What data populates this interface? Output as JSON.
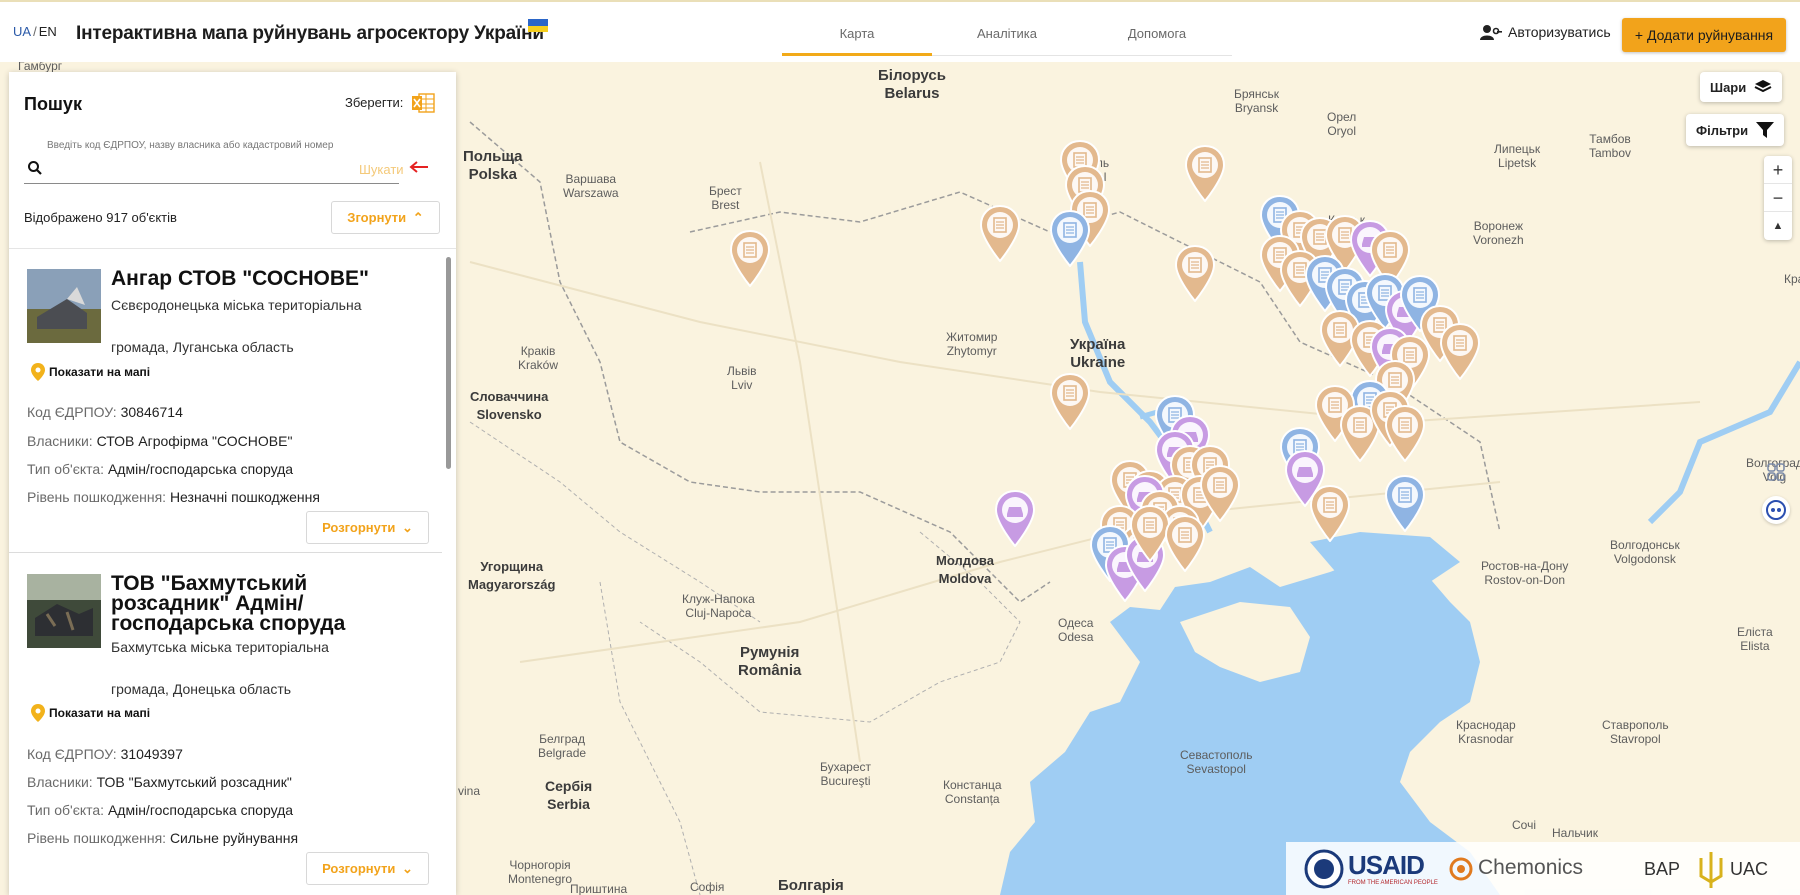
{
  "header": {
    "lang_ua": "UA",
    "lang_sep": "/",
    "lang_en": "EN",
    "title": "Інтерактивна мапа руйнувань агросектору України",
    "nav": [
      "Карта",
      "Аналітика",
      "Допомога"
    ],
    "active_nav": "Карта",
    "login": "Авторизуватись",
    "add_button": "+ Додати руйнування",
    "colors": {
      "accent": "#f2a31b",
      "flag_blue": "#2b66c8",
      "flag_yellow": "#f6cf1e"
    }
  },
  "sidebar": {
    "title": "Пошук",
    "save_label": "Зберегти:",
    "save_icon": "excel-icon",
    "search_hint": "Введіть код ЄДРПОУ, назву власника або кадастровий номер",
    "search_value": "",
    "search_button": "Шукати",
    "count_text": "Відображено 917 об'єктів",
    "collapse_button": "Згорнути",
    "show_on_map": "Показати на мапі",
    "expand_button": "Розгорнути",
    "labels": {
      "code": "Код ЄДРПОУ:",
      "owner": "Власники:",
      "type": "Тип об'єкта:",
      "damage": "Рівень пошкодження:"
    },
    "cards": [
      {
        "title": "Ангар СТОВ \"СОСНОВЕ\"",
        "location_1": "Сєвєродонецька міська територіальна",
        "location_2": "громада, Луганська область",
        "code": "30846714",
        "owner": "СТОВ Агрофірма \"СОСНОВЕ\"",
        "type": "Адмін/господарська споруда",
        "damage": "Незначні пошкодження"
      },
      {
        "title": "ТОВ \"Бахмутський розсадник\" Адмін/ господарська споруда",
        "location_1": "Бахмутська міська територіальна",
        "location_2": "громада, Донецька область",
        "code": "31049397",
        "owner": "ТОВ \"Бахмутський розсадник\"",
        "type": "Адмін/господарська споруда",
        "damage": "Сильне руйнування"
      }
    ]
  },
  "map": {
    "layers_button": "Шари",
    "filters_button": "Фільтри",
    "zoom_in": "+",
    "zoom_out": "−",
    "compass": "▲",
    "countries": [
      {
        "name": "Білорусь\nBelarus"
      },
      {
        "name": "Польща\nPolska"
      },
      {
        "name": "Україна\nUkraine"
      },
      {
        "name": "Словаччина\nSlovensko"
      },
      {
        "name": "Угорщина\nMagyarország"
      },
      {
        "name": "Молдова\nMoldova"
      },
      {
        "name": "Румунія\nRomânia"
      },
      {
        "name": "Сербія\nSerbia"
      },
      {
        "name": "Болгарія"
      }
    ],
    "cities": [
      "Гамбург",
      "Брянськ\nBryansk",
      "Орел\nOryol",
      "Тамбов\nTambov",
      "Липецьк\nLipetsk",
      "Варшава\nWarszawa",
      "Брест\nBrest",
      "Гомель\nHomel",
      "Курськ\nKursk",
      "Воронеж\nVoronezh",
      "Краків\nKraków",
      "Львів\nLviv",
      "Житомир\nZhytomyr",
      "Одеса\nOdesa",
      "Клуж-Напока\nCluj-Napoca",
      "Ростов-на-Дону\nRostov-on-Don",
      "Волгодонськ\nVolgodonsk",
      "Еліста\nElista",
      "Бухарест\nBucureşti",
      "Констанца\nConstanța",
      "Севастополь\nSevastopol",
      "Краснодар\nKrasnodar",
      "Ставрополь\nStavropol",
      "Белград\nBelgrade",
      "Чорногорія\nMontenegro",
      "Приштина",
      "Софія",
      "Сочі",
      "Нальчик",
      "Волгоград\nVolg",
      "Кра",
      "vina"
    ],
    "pin_categories": {
      "building": "#e3b98e",
      "infrastructure": "#8fb4e3",
      "vehicle": "#c79be3"
    },
    "footer_logos": [
      "USAID",
      "FROM THE AMERICAN PEOPLE",
      "Chemonics",
      "BAP",
      "UAC"
    ]
  }
}
